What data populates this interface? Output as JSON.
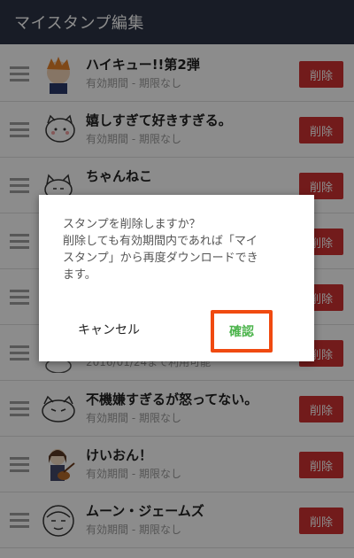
{
  "header": {
    "title": "マイスタンプ編集"
  },
  "rows": [
    {
      "name": "ハイキュー!!第2弾",
      "validity": "有効期間 - 期限なし",
      "delete": "削除"
    },
    {
      "name": "嬉しすぎて好きすぎる。",
      "validity": "有効期間 - 期限なし",
      "delete": "削除"
    },
    {
      "name": "ちゃんねこ",
      "validity": "",
      "delete": "削除"
    },
    {
      "name": "",
      "validity": "",
      "delete": "削除"
    },
    {
      "name": "",
      "validity": "",
      "delete": "削除"
    },
    {
      "name": "",
      "validity": "2016/01/24まで利用可能",
      "delete": "削除"
    },
    {
      "name": "不機嫌すぎるが怒ってない。",
      "validity": "有効期間 - 期限なし",
      "delete": "削除"
    },
    {
      "name": "けいおん！",
      "validity": "有効期間 - 期限なし",
      "delete": "削除"
    },
    {
      "name": "ムーン・ジェームズ",
      "validity": "有効期間 - 期限なし",
      "delete": "削除"
    }
  ],
  "dialog": {
    "message_lines": [
      "スタンプを削除しますか？",
      "削除しても有効期間内であれば「マイ",
      "スタンプ」から再度ダウンロードでき",
      "ます。"
    ],
    "cancel": "キャンセル",
    "confirm": "確認"
  },
  "colors": {
    "header_bg": "#2c3445",
    "delete_bg": "#d03232",
    "confirm_text": "#4cb44c",
    "highlight_border": "#f04a10"
  }
}
